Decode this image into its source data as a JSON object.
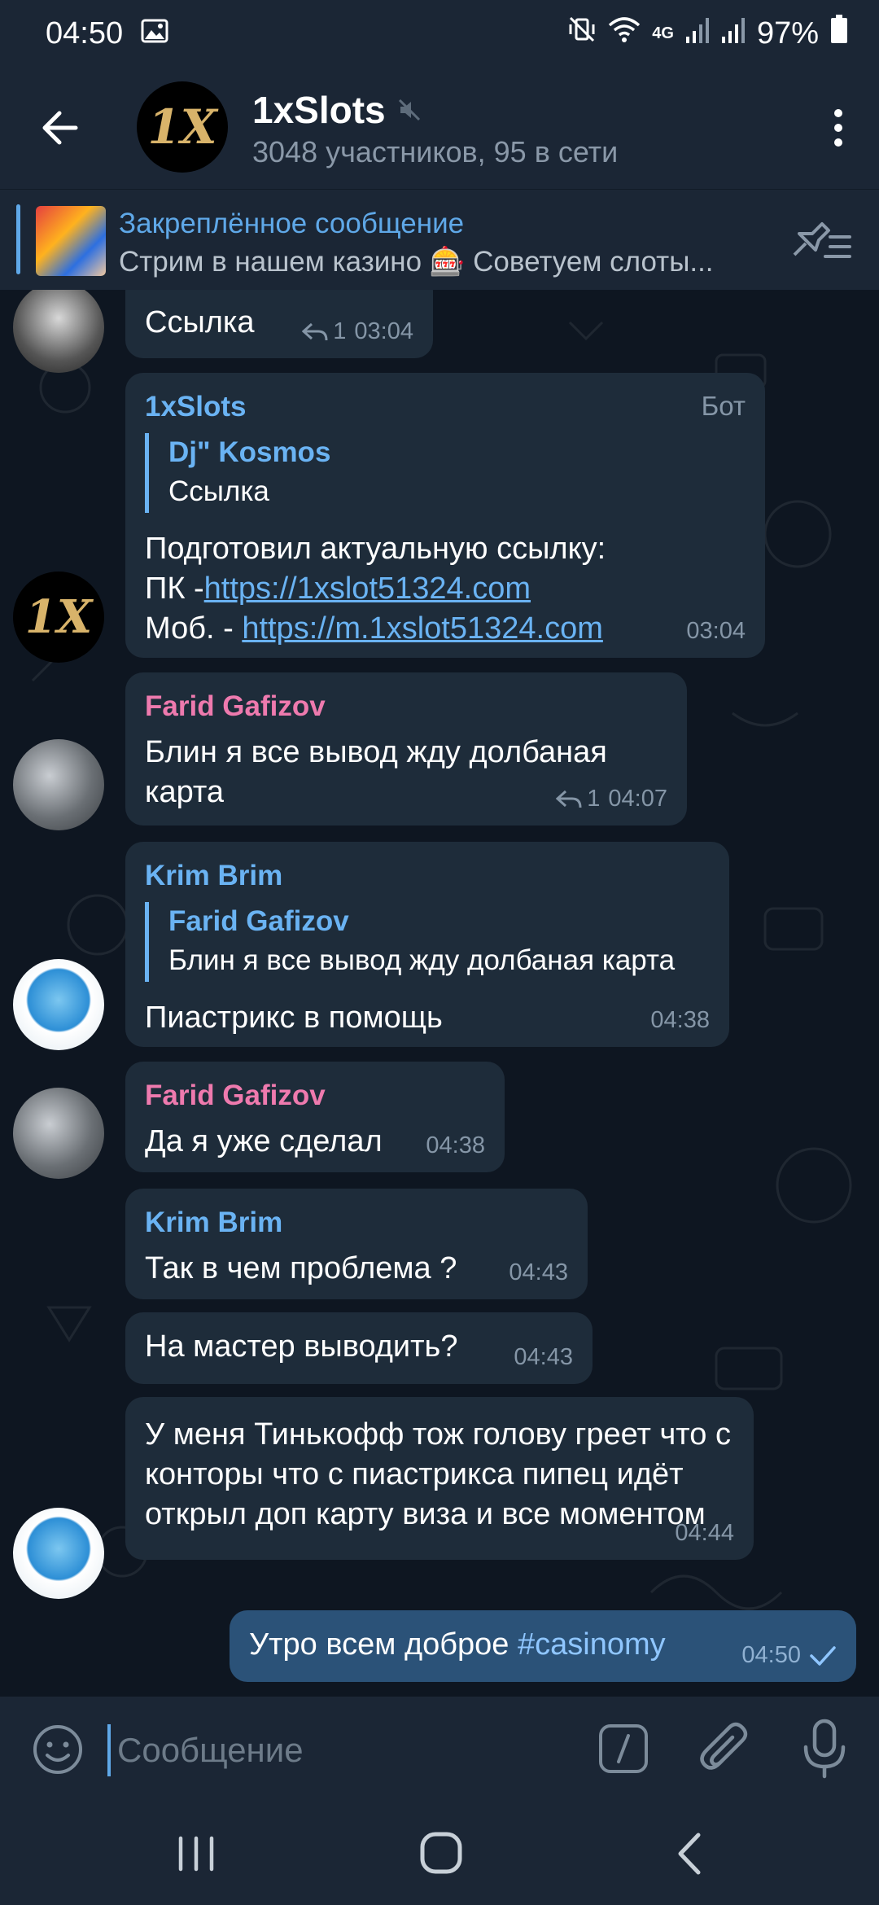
{
  "status_bar": {
    "time": "04:50",
    "network": "4G",
    "battery": "97%"
  },
  "header": {
    "back_icon": "arrow-left-icon",
    "title": "1xSlots",
    "muted_icon": "speaker-muted-icon",
    "subtitle": "3048 участников, 95 в сети",
    "avatar_text": "1X"
  },
  "pinned": {
    "title": "Закреплённое сообщение",
    "text": "Стрим в нашем казино 🎰 Советуем слоты..."
  },
  "messages": [
    {
      "text": "Ссылка",
      "replies": "1",
      "time": "03:04"
    },
    {
      "sender": "1xSlots",
      "tag": "Бот",
      "quote_name": "Dj\" Kosmos",
      "quote_text": "Ссылка",
      "line1": "Подготовил актуальную ссылку:",
      "line2_prefix": "ПК -",
      "link1": "https://1xslot51324.com",
      "line3_prefix": "Моб. - ",
      "link2": "https://m.1xslot51324.com",
      "time": "03:04",
      "avatar_text": "1X"
    },
    {
      "sender": "Farid Gafizov",
      "text": "Блин я все вывод жду долбаная карта",
      "replies": "1",
      "time": "04:07"
    },
    {
      "sender": "Krim Brim",
      "quote_name": "Farid Gafizov",
      "quote_text": "Блин я все вывод жду долбаная карта",
      "text": "Пиастрикс в помощь",
      "time": "04:38"
    },
    {
      "sender": "Farid Gafizov",
      "text": "Да я уже сделал",
      "time": "04:38"
    },
    {
      "sender": "Krim Brim",
      "text": "Так в чем проблема ?",
      "time": "04:43"
    },
    {
      "text": "На мастер выводить?",
      "time": "04:43"
    },
    {
      "text": "У меня Тинькофф тож голову греет что с конторы что с пиастрикса пипец идёт открыл доп карту виза и все моментом",
      "time": "04:44"
    },
    {
      "text_prefix": "Утро всем доброе ",
      "hashtag": "#casinomy",
      "time": "04:50"
    }
  ],
  "input": {
    "placeholder": "Сообщение"
  },
  "colors": {
    "header_bg": "#1b2635",
    "chat_bg": "#0e1621",
    "bubble_in": "#1e2c3a",
    "bubble_out": "#2b5278",
    "link": "#6ab3f3",
    "name_pink": "#ee7aae"
  }
}
